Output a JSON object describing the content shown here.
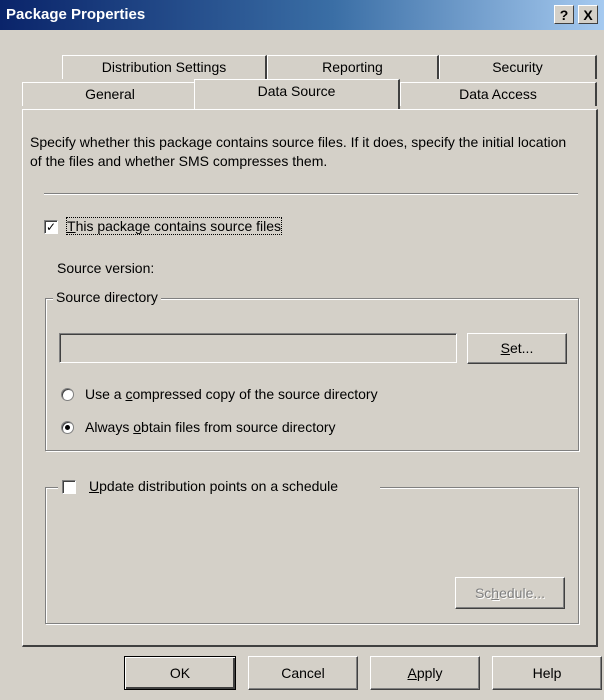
{
  "window": {
    "title": "Package Properties",
    "help_label": "?",
    "close_label": "X"
  },
  "tabs_back": [
    {
      "label": "Distribution Settings"
    },
    {
      "label": "Reporting"
    },
    {
      "label": "Security"
    }
  ],
  "tabs_front": [
    {
      "label": "General"
    },
    {
      "label": "Data Source",
      "active": true
    },
    {
      "label": "Data Access"
    }
  ],
  "content": {
    "description": "Specify whether this package contains source files.  If it does, specify the initial location of the files and whether SMS compresses them.",
    "contains_source": {
      "pre": "",
      "accel": "T",
      "post": "his package contains source files",
      "checked": true,
      "mark": "✓"
    },
    "source_version_label": "Source version:",
    "source_directory": {
      "legend": "Source directory",
      "path_value": "",
      "set_button": {
        "accel": "S",
        "post": "et..."
      },
      "options": [
        {
          "pre": "Use a ",
          "accel": "c",
          "post": "ompressed copy of the source directory",
          "selected": false
        },
        {
          "pre": "Always ",
          "accel": "o",
          "post": "btain files from source directory",
          "selected": true
        }
      ]
    },
    "update_schedule": {
      "pre": "",
      "accel": "U",
      "post": "pdate distribution points on a schedule",
      "checked": false,
      "schedule_button": {
        "pre": "Sc",
        "accel": "h",
        "post": "edule...",
        "enabled": false
      }
    }
  },
  "footer": {
    "ok": {
      "label": "OK"
    },
    "cancel": {
      "label": "Cancel"
    },
    "apply": {
      "accel": "A",
      "post": "pply"
    },
    "help": {
      "label": "Help"
    }
  }
}
